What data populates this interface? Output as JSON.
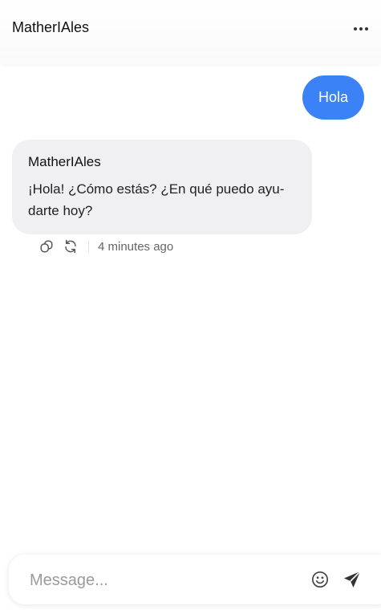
{
  "header": {
    "title": "MatherIAles",
    "menu_icon": "more-horizontal-icon"
  },
  "messages": [
    {
      "role": "user",
      "text": "Hola"
    },
    {
      "role": "assistant",
      "sender": "MatherIAles",
      "text": "¡Hola! ¿Cómo estás? ¿En qué puedo ayu-darte hoy?",
      "timestamp": "4 minutes ago",
      "actions": [
        "copy-icon",
        "regenerate-icon"
      ]
    }
  ],
  "composer": {
    "placeholder": "Message...",
    "value": "",
    "emoji_icon": "emoji-icon",
    "send_icon": "send-icon"
  },
  "colors": {
    "accent": "#3b82f6",
    "assistant_bubble": "#f0f0f2",
    "muted_text": "#666666"
  }
}
